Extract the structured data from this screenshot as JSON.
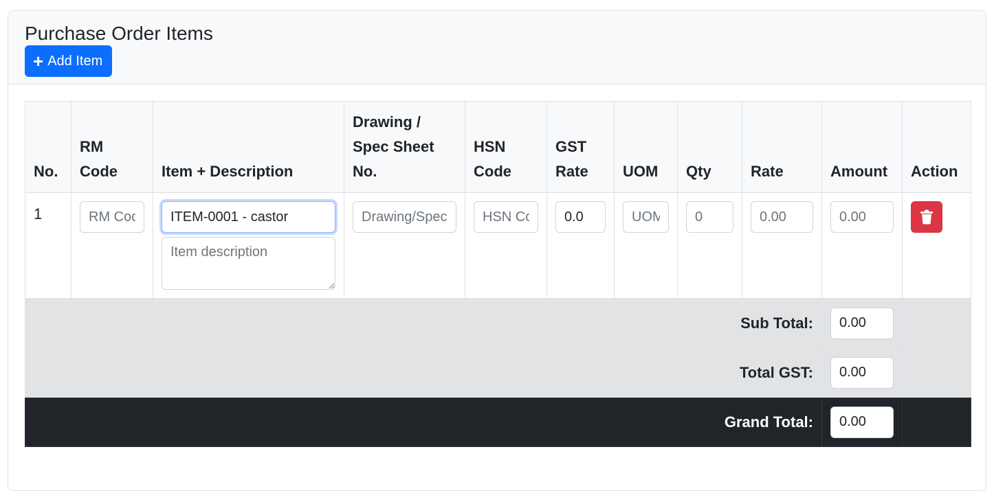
{
  "card": {
    "title": "Purchase Order Items",
    "add_button_label": "Add Item"
  },
  "table": {
    "headers": {
      "no": "No.",
      "rm_code": "RM Code",
      "item_description": "Item + Description",
      "drawing_spec": "Drawing / Spec Sheet No.",
      "hsn_code": "HSN Code",
      "gst_rate": "GST Rate",
      "uom": "UOM",
      "qty": "Qty",
      "rate": "Rate",
      "amount": "Amount",
      "action": "Action"
    },
    "rows": [
      {
        "no": "1",
        "rm_code": {
          "value": "",
          "placeholder": "RM Code"
        },
        "item": {
          "value": "ITEM-0001 - castor",
          "placeholder": ""
        },
        "description": {
          "value": "",
          "placeholder": "Item description"
        },
        "drawing_spec": {
          "value": "",
          "placeholder": "Drawing/Spec"
        },
        "hsn_code": {
          "value": "",
          "placeholder": "HSN Code"
        },
        "gst_rate": {
          "value": "0.0",
          "placeholder": ""
        },
        "uom": {
          "value": "",
          "placeholder": "UOM"
        },
        "qty": {
          "value": "",
          "placeholder": "0"
        },
        "rate": {
          "value": "",
          "placeholder": "0.00"
        },
        "amount": {
          "value": "",
          "placeholder": "0.00"
        },
        "action_icon": "trash-icon"
      }
    ]
  },
  "totals": {
    "sub_total_label": "Sub Total:",
    "sub_total_value": "0.00",
    "total_gst_label": "Total GST:",
    "total_gst_value": "0.00",
    "grand_total_label": "Grand Total:",
    "grand_total_value": "0.00"
  },
  "colors": {
    "primary": "#0d6efd",
    "danger": "#dc3545",
    "dark": "#212529",
    "secondary_bg": "#e2e3e5"
  }
}
